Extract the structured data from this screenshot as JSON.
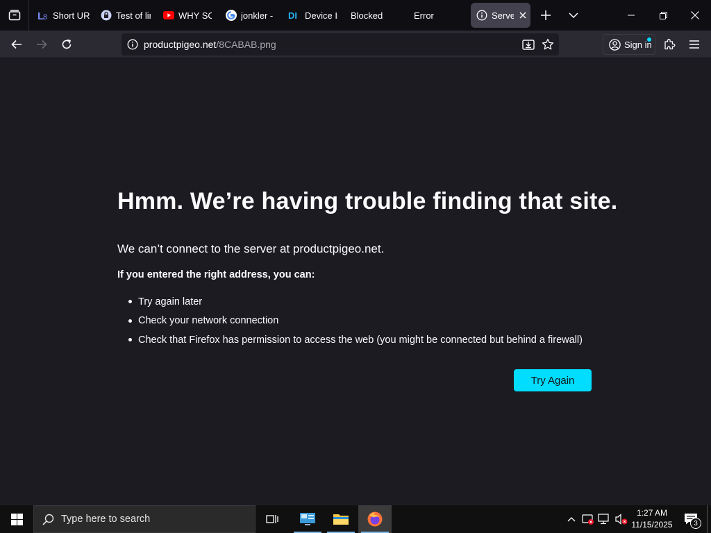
{
  "colors": {
    "accent": "#00ddff",
    "page_bg": "#1c1b22",
    "tab_bar_bg": "#0f0e13",
    "toolbar_bg": "#2b2a33",
    "taskbar_bg": "#101010"
  },
  "tabs": [
    {
      "title": "Short UR",
      "icon": "l8-logo-icon"
    },
    {
      "title": "Test of lin",
      "icon": "lock-badge-icon"
    },
    {
      "title": "WHY SO",
      "icon": "youtube-icon"
    },
    {
      "title": "jonkler -",
      "icon": "google-icon"
    },
    {
      "title": "Device In",
      "icon": "di-logo-icon"
    },
    {
      "title": "Blocked",
      "icon": ""
    },
    {
      "title": "Error",
      "icon": ""
    },
    {
      "title": "Server",
      "icon": "info-icon",
      "active": true
    }
  ],
  "toolbar": {
    "url_host": "productpigeo.net",
    "url_path": "/8CABAB.png",
    "signin_label": "Sign in"
  },
  "error": {
    "title": "Hmm. We’re having trouble finding that site.",
    "description": "We can’t connect to the server at productpigeo.net.",
    "subheading": "If you entered the right address, you can:",
    "suggestions": [
      "Try again later",
      "Check your network connection",
      "Check that Firefox has permission to access the web (you might be connected but behind a firewall)"
    ],
    "button_label": "Try Again"
  },
  "taskbar": {
    "search_placeholder": "Type here to search",
    "time": "1:27 AM",
    "date": "11/15/2025",
    "notification_count": "3"
  }
}
